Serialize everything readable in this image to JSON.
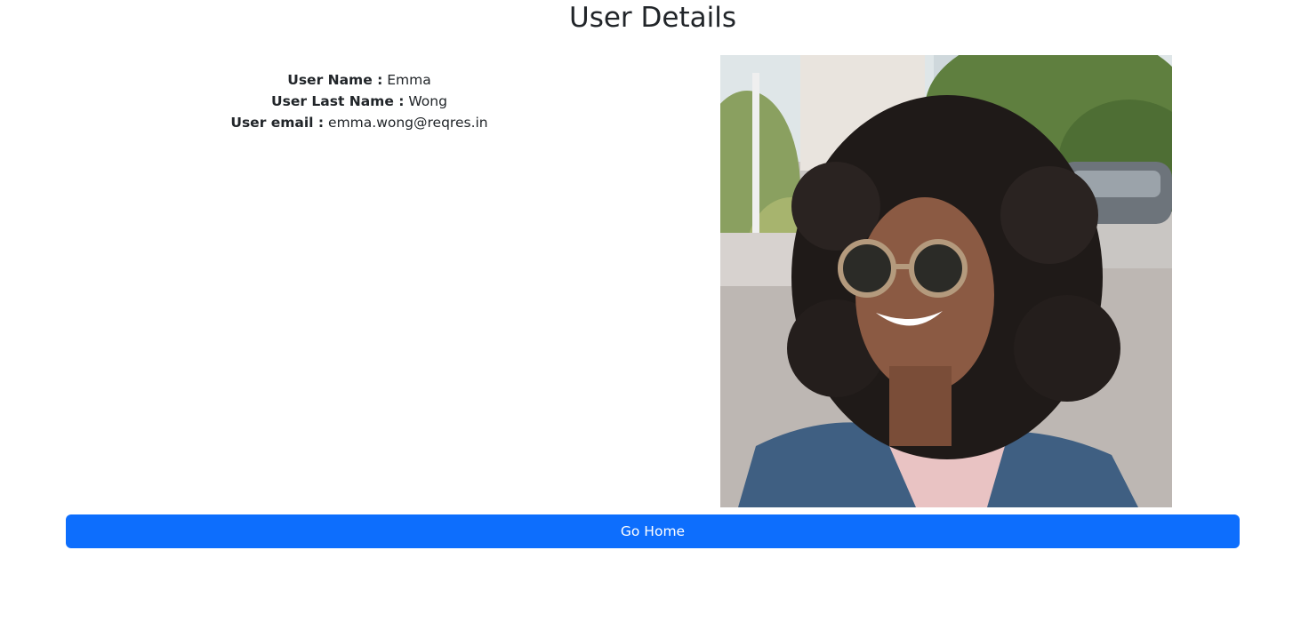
{
  "page": {
    "title": "User Details"
  },
  "user": {
    "first_name_label": "User Name :",
    "first_name": "Emma",
    "last_name_label": "User Last Name :",
    "last_name": "Wong",
    "email_label": "User email :",
    "email": "emma.wong@reqres.in"
  },
  "actions": {
    "go_home_label": "Go Home"
  },
  "colors": {
    "primary_button": "#0d6efd",
    "text": "#212529"
  }
}
